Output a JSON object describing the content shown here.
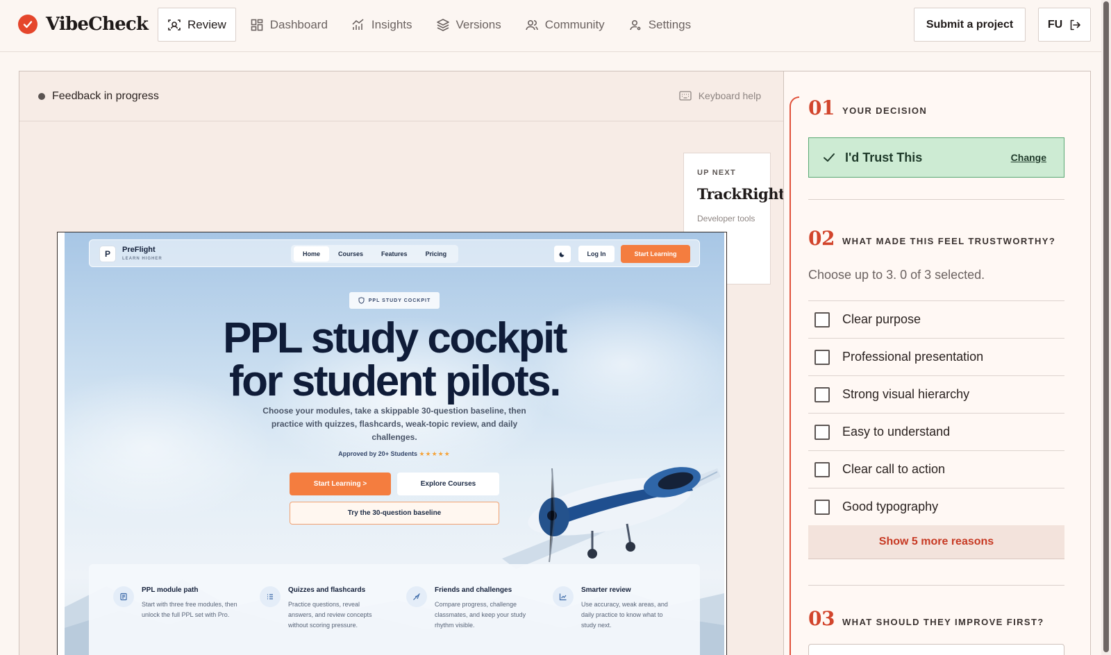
{
  "app": {
    "name": "VibeCheck",
    "accent": "#e5462c"
  },
  "nav": {
    "items": [
      {
        "label": "Review",
        "icon": "scan-icon",
        "active": true
      },
      {
        "label": "Dashboard",
        "icon": "grid-icon",
        "active": false
      },
      {
        "label": "Insights",
        "icon": "chart-icon",
        "active": false
      },
      {
        "label": "Versions",
        "icon": "layers-icon",
        "active": false
      },
      {
        "label": "Community",
        "icon": "users-icon",
        "active": false
      },
      {
        "label": "Settings",
        "icon": "user-settings-icon",
        "active": false
      }
    ],
    "submit_label": "Submit a project",
    "user_initials": "FU"
  },
  "review": {
    "status": "Feedback in progress",
    "keyboard_help": "Keyboard help",
    "up_next": {
      "label": "UP NEXT",
      "title": "TrackRight!",
      "category": "Developer tools"
    }
  },
  "preview": {
    "brand": "PreFlight",
    "tagline": "LEARN HIGHER",
    "logo_letter": "P",
    "links": [
      "Home",
      "Courses",
      "Features",
      "Pricing"
    ],
    "login": "Log In",
    "start": "Start Learning",
    "badge": "PPL STUDY COCKPIT",
    "headline_1": "PPL study cockpit",
    "headline_2": "for student pilots.",
    "subtitle": "Choose your modules, take a skippable 30-question baseline, then practice with quizzes, flashcards, weak-topic review, and daily challenges.",
    "approved": "Approved by 20+ Students",
    "stars": "★★★★★",
    "cta_primary": "Start Learning >",
    "cta_secondary": "Explore Courses",
    "cta_baseline": "Try the 30-question baseline",
    "features": [
      {
        "title": "PPL module path",
        "desc": "Start with three free modules, then unlock the full PPL set with Pro.",
        "icon": "book-icon"
      },
      {
        "title": "Quizzes and flashcards",
        "desc": "Practice questions, reveal answers, and review concepts without scoring pressure.",
        "icon": "list-icon"
      },
      {
        "title": "Friends and challenges",
        "desc": "Compare progress, challenge classmates, and keep your study rhythm visible.",
        "icon": "plane-icon"
      },
      {
        "title": "Smarter review",
        "desc": "Use accuracy, weak areas, and daily practice to know what to study next.",
        "icon": "trend-icon"
      }
    ]
  },
  "panel": {
    "sections": [
      {
        "num": "01",
        "title": "YOUR DECISION"
      },
      {
        "num": "02",
        "title": "WHAT MADE THIS FEEL TRUSTWORTHY?"
      },
      {
        "num": "03",
        "title": "WHAT SHOULD THEY IMPROVE FIRST?"
      }
    ],
    "decision": {
      "label": "I'd Trust This",
      "change": "Change",
      "color": "#cdebd3"
    },
    "hint": "Choose up to 3. 0 of 3 selected.",
    "reasons": [
      "Clear purpose",
      "Professional presentation",
      "Strong visual hierarchy",
      "Easy to understand",
      "Clear call to action",
      "Good typography"
    ],
    "show_more": "Show 5 more reasons"
  }
}
